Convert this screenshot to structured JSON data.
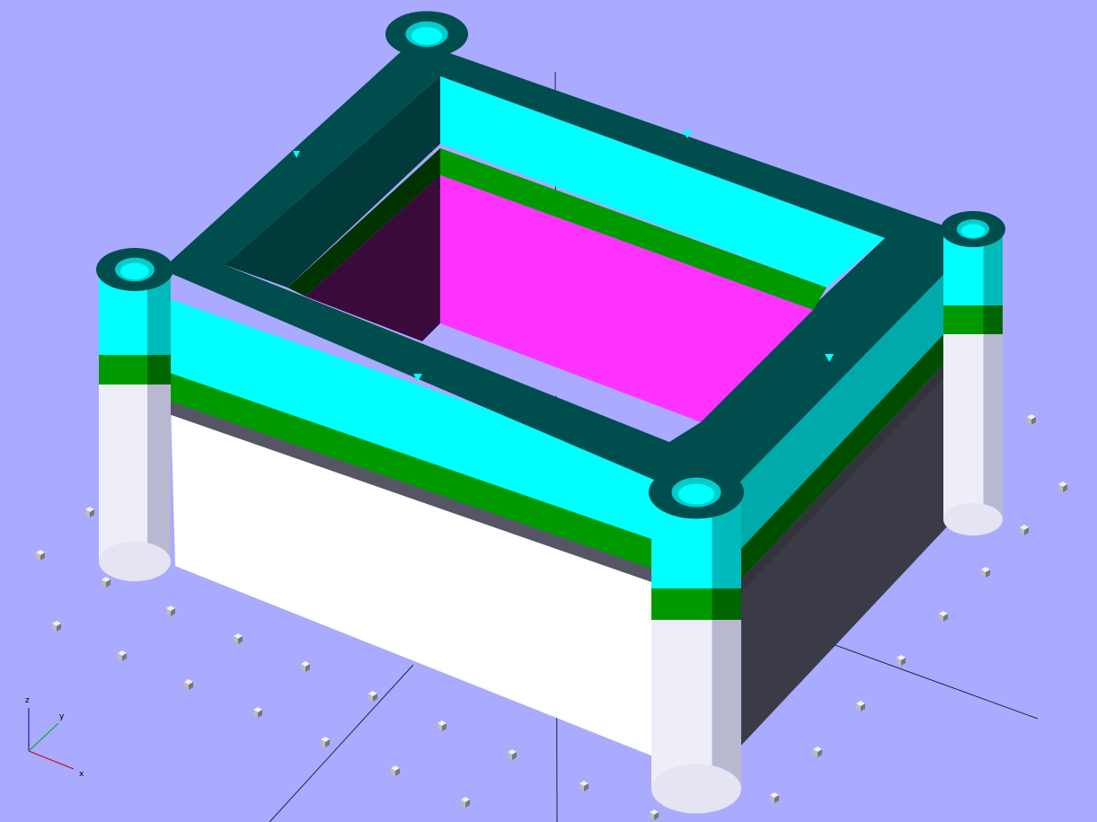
{
  "app": {
    "kind": "3d-cad-preview"
  },
  "colors": {
    "background": "#aaaaff",
    "wall_white": "#ffffff",
    "wall_dark": "#3b3b48",
    "rim_cyan": "#00ffff",
    "band_green": "#00aa00",
    "lid_top": "#004d4d",
    "inner_magenta": "#ff33ff",
    "inner_dark": "#3a0a3a",
    "post_white": "#eeeef8",
    "axis_x": "#cc0000",
    "axis_y": "#00aa00",
    "axis_z": "#0000cc"
  },
  "axes_indicator": {
    "x_label": "x",
    "y_label": "y",
    "z_label": "z"
  }
}
